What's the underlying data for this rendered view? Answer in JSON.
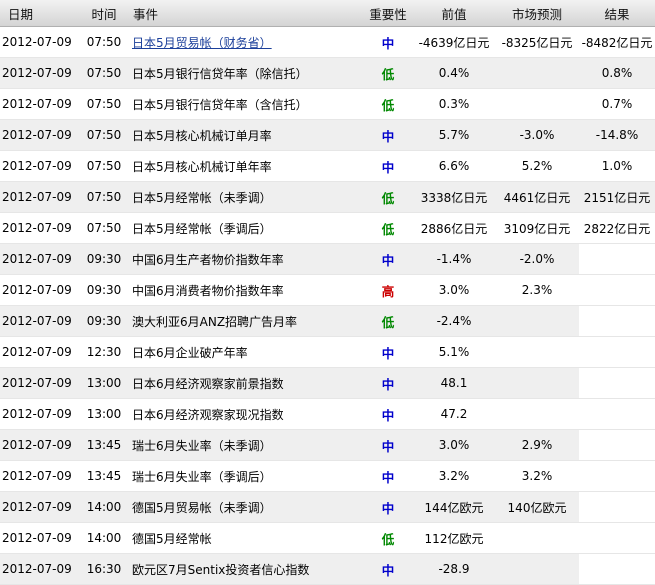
{
  "columns": [
    "日期",
    "时间",
    "事件",
    "重要性",
    "前值",
    "市场预测",
    "结果"
  ],
  "importance_colors": {
    "中": "#0000cc",
    "低": "#008800",
    "高": "#cc0000"
  },
  "rows": [
    {
      "date": "2012-07-09",
      "time": "07:50",
      "event": "日本5月贸易帐（财务省）",
      "importance": "中",
      "previous": "-4639亿日元",
      "forecast": "-8325亿日元",
      "actual": "-8482亿日元",
      "link": true
    },
    {
      "date": "2012-07-09",
      "time": "07:50",
      "event": "日本5月银行信贷年率（除信托）",
      "importance": "低",
      "previous": "0.4%",
      "forecast": "",
      "actual": "0.8%"
    },
    {
      "date": "2012-07-09",
      "time": "07:50",
      "event": "日本5月银行信贷年率（含信托）",
      "importance": "低",
      "previous": "0.3%",
      "forecast": "",
      "actual": "0.7%"
    },
    {
      "date": "2012-07-09",
      "time": "07:50",
      "event": "日本5月核心机械订单月率",
      "importance": "中",
      "previous": "5.7%",
      "forecast": "-3.0%",
      "actual": "-14.8%"
    },
    {
      "date": "2012-07-09",
      "time": "07:50",
      "event": "日本5月核心机械订单年率",
      "importance": "中",
      "previous": "6.6%",
      "forecast": "5.2%",
      "actual": "1.0%"
    },
    {
      "date": "2012-07-09",
      "time": "07:50",
      "event": "日本5月经常帐（未季调）",
      "importance": "低",
      "previous": "3338亿日元",
      "forecast": "4461亿日元",
      "actual": "2151亿日元"
    },
    {
      "date": "2012-07-09",
      "time": "07:50",
      "event": "日本5月经常帐（季调后）",
      "importance": "低",
      "previous": "2886亿日元",
      "forecast": "3109亿日元",
      "actual": "2822亿日元"
    },
    {
      "date": "2012-07-09",
      "time": "09:30",
      "event": "中国6月生产者物价指数年率",
      "importance": "中",
      "previous": "-1.4%",
      "forecast": "-2.0%",
      "actual": ""
    },
    {
      "date": "2012-07-09",
      "time": "09:30",
      "event": "中国6月消费者物价指数年率",
      "importance": "高",
      "previous": "3.0%",
      "forecast": "2.3%",
      "actual": ""
    },
    {
      "date": "2012-07-09",
      "time": "09:30",
      "event": "澳大利亚6月ANZ招聘广告月率",
      "importance": "低",
      "previous": "-2.4%",
      "forecast": "",
      "actual": ""
    },
    {
      "date": "2012-07-09",
      "time": "12:30",
      "event": "日本6月企业破产年率",
      "importance": "中",
      "previous": "5.1%",
      "forecast": "",
      "actual": ""
    },
    {
      "date": "2012-07-09",
      "time": "13:00",
      "event": "日本6月经济观察家前景指数",
      "importance": "中",
      "previous": "48.1",
      "forecast": "",
      "actual": ""
    },
    {
      "date": "2012-07-09",
      "time": "13:00",
      "event": "日本6月经济观察家现况指数",
      "importance": "中",
      "previous": "47.2",
      "forecast": "",
      "actual": ""
    },
    {
      "date": "2012-07-09",
      "time": "13:45",
      "event": "瑞士6月失业率（未季调）",
      "importance": "中",
      "previous": "3.0%",
      "forecast": "2.9%",
      "actual": ""
    },
    {
      "date": "2012-07-09",
      "time": "13:45",
      "event": "瑞士6月失业率（季调后）",
      "importance": "中",
      "previous": "3.2%",
      "forecast": "3.2%",
      "actual": ""
    },
    {
      "date": "2012-07-09",
      "time": "14:00",
      "event": "德国5月贸易帐（未季调）",
      "importance": "中",
      "previous": "144亿欧元",
      "forecast": "140亿欧元",
      "actual": ""
    },
    {
      "date": "2012-07-09",
      "time": "14:00",
      "event": "德国5月经常帐",
      "importance": "低",
      "previous": "112亿欧元",
      "forecast": "",
      "actual": ""
    },
    {
      "date": "2012-07-09",
      "time": "16:30",
      "event": "欧元区7月Sentix投资者信心指数",
      "importance": "中",
      "previous": "-28.9",
      "forecast": "",
      "actual": ""
    }
  ]
}
